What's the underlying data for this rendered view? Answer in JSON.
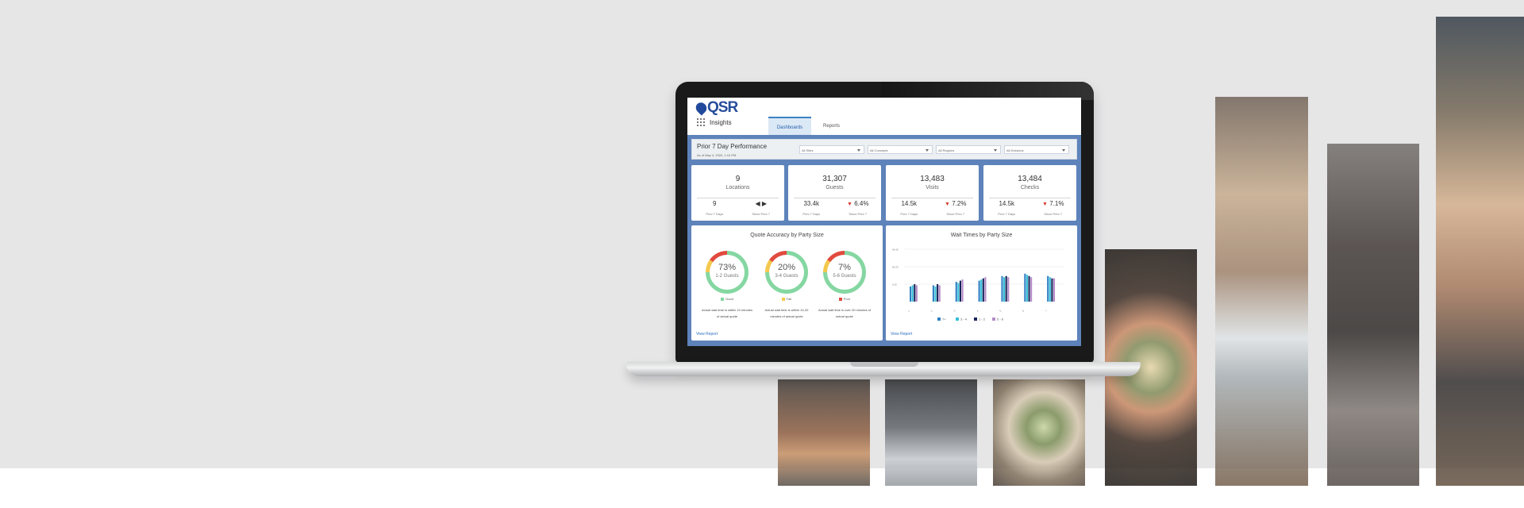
{
  "app": {
    "brand": "QSR",
    "title": "Insights",
    "tabs": [
      "Dashboards",
      "Reports"
    ]
  },
  "filters": {
    "title": "Prior 7 Day Performance",
    "subtitle": "As of May 4, 2020, 1:10 PM",
    "sites": "All Sites",
    "concepts": "All Concepts",
    "regions": "All Regions",
    "divisions": "All Divisions"
  },
  "kpis": [
    {
      "value": "9",
      "label": "Locations",
      "prev": "9",
      "prev_label": "Prev 7 Days",
      "change": "◀ ▶",
      "change_label": "Since Prev 7"
    },
    {
      "value": "31,307",
      "label": "Guests",
      "prev": "33.4k",
      "prev_label": "Prev 7 Days",
      "change": "6.4%",
      "change_label": "Since Prev 7"
    },
    {
      "value": "13,483",
      "label": "Visits",
      "prev": "14.5k",
      "prev_label": "Prev 7 Days",
      "change": "7.2%",
      "change_label": "Since Prev 7"
    },
    {
      "value": "13,484",
      "label": "Checks",
      "prev": "14.5k",
      "prev_label": "Prev 7 Days",
      "change": "7.1%",
      "change_label": "Since Prev 7"
    }
  ],
  "quote_panel": {
    "title": "Quote Accuracy by Party Size",
    "donuts": [
      {
        "pct": "73%",
        "label": "1-2 Guests",
        "legend": "Good",
        "note": "Actual wait time is within 10 minutes of actual quote"
      },
      {
        "pct": "20%",
        "label": "3-4 Guests",
        "legend": "Fair",
        "note": "Actual wait time is within 10-20 minutes of actual quote"
      },
      {
        "pct": "7%",
        "label": "5-6 Guests",
        "legend": "Poor",
        "note": "Actual wait time is over 20 minutes of actual quote"
      }
    ],
    "view_report": "View Report"
  },
  "chart_data": {
    "type": "bar",
    "title": "Wait Times by Party Size",
    "categories": [
      "1",
      "2",
      "3",
      "4",
      "5",
      "6",
      "7"
    ],
    "ylim": [
      0,
      45
    ],
    "yticks": [
      "00:45",
      "00:30",
      "0:15"
    ],
    "series": [
      {
        "name": "7+",
        "values": [
          13,
          14,
          17,
          18,
          22,
          24,
          22
        ]
      },
      {
        "name": "3 - 4",
        "values": [
          14,
          13,
          16,
          19,
          21,
          23,
          21
        ]
      },
      {
        "name": "1 - 2",
        "values": [
          15,
          15,
          18,
          20,
          22,
          22,
          20
        ]
      },
      {
        "name": "5 - 6",
        "values": [
          14,
          14,
          19,
          21,
          21,
          21,
          20
        ]
      }
    ],
    "colors": [
      "#2f7fc5",
      "#35bfd8",
      "#1a255a",
      "#b58ac9"
    ],
    "view_report": "View Report"
  }
}
